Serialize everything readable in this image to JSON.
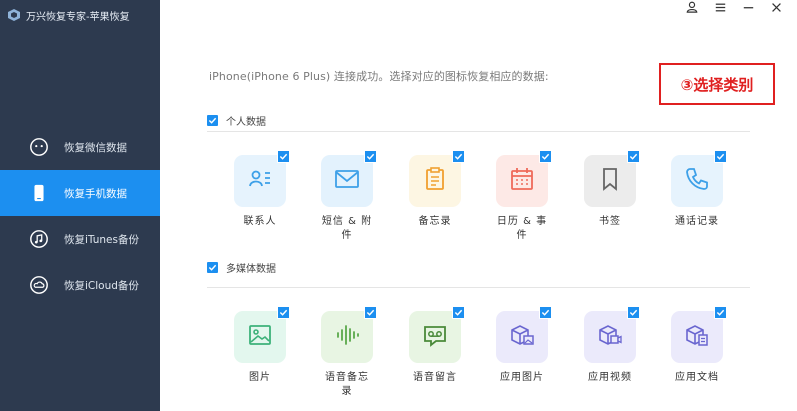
{
  "app": {
    "title": "万兴恢复专家-苹果恢复"
  },
  "sidebar": {
    "items": [
      {
        "label": "恢复微信数据",
        "icon": "wechat-icon",
        "active": false
      },
      {
        "label": "恢复手机数据",
        "icon": "phone-icon",
        "active": true
      },
      {
        "label": "恢复iTunes备份",
        "icon": "itunes-icon",
        "active": false
      },
      {
        "label": "恢复iCloud备份",
        "icon": "icloud-icon",
        "active": false
      }
    ]
  },
  "window_controls": [
    "user-icon",
    "menu-icon",
    "minimize-icon",
    "close-icon"
  ],
  "main": {
    "status_text": "iPhone(iPhone 6 Plus) 连接成功。选择对应的图标恢复相应的数据:",
    "annotation": "③选择类别",
    "sections": [
      {
        "title": "个人数据",
        "checked": true,
        "items": [
          {
            "label": "联系人",
            "icon": "contacts-icon",
            "checked": true,
            "color": "#e6f3fd",
            "icon_color": "#3da0e8"
          },
          {
            "label": "短信 & 附件",
            "icon": "message-icon",
            "checked": true,
            "color": "#e3f2fd",
            "icon_color": "#3da0e8"
          },
          {
            "label": "备忘录",
            "icon": "notes-icon",
            "checked": true,
            "color": "#fdf6e3",
            "icon_color": "#f0a030"
          },
          {
            "label": "日历 & 事件",
            "icon": "calendar-icon",
            "checked": true,
            "color": "#fde9e6",
            "icon_color": "#ef6a5a"
          },
          {
            "label": "书签",
            "icon": "bookmark-icon",
            "checked": true,
            "color": "#ececec",
            "icon_color": "#666666"
          },
          {
            "label": "通话记录",
            "icon": "call-icon",
            "checked": true,
            "color": "#e6f3fd",
            "icon_color": "#3da0e8"
          }
        ]
      },
      {
        "title": "多媒体数据",
        "checked": true,
        "items": [
          {
            "label": "图片",
            "icon": "photo-icon",
            "checked": true,
            "color": "#e3f7ee",
            "icon_color": "#3db27a"
          },
          {
            "label": "语音备忘录",
            "icon": "voice-memo-icon",
            "checked": true,
            "color": "#e8f5e3",
            "icon_color": "#5aa84a"
          },
          {
            "label": "语音留言",
            "icon": "voicemail-icon",
            "checked": true,
            "color": "#e8f5e3",
            "icon_color": "#4a8a3a"
          },
          {
            "label": "应用图片",
            "icon": "app-photo-icon",
            "checked": true,
            "color": "#ebeafb",
            "icon_color": "#6a66d0"
          },
          {
            "label": "应用视频",
            "icon": "app-video-icon",
            "checked": true,
            "color": "#ebeafb",
            "icon_color": "#6a66d0"
          },
          {
            "label": "应用文档",
            "icon": "app-document-icon",
            "checked": true,
            "color": "#ebeafb",
            "icon_color": "#6a66d0"
          }
        ]
      }
    ]
  },
  "colors": {
    "sidebar_bg": "#2d3a4f",
    "accent": "#1c8ff0",
    "annotation": "#e02020"
  }
}
